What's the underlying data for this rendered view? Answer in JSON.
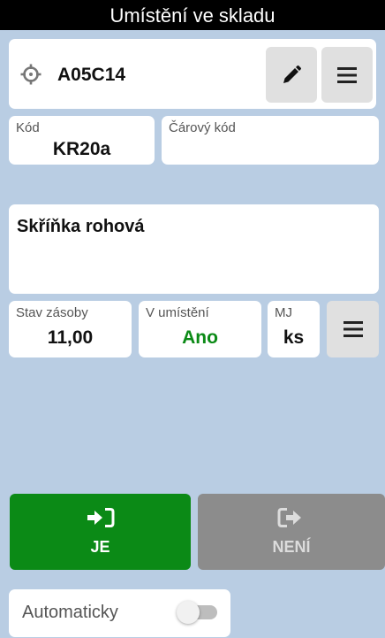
{
  "window": {
    "title": "Umístění ve skladu"
  },
  "location": {
    "code": "A05C14",
    "icon": "crosshair-icon",
    "edit_icon": "pencil-icon",
    "menu_icon": "hamburger-menu-icon"
  },
  "fields": {
    "kod": {
      "label": "Kód",
      "value": "KR20a"
    },
    "carovy_kod": {
      "label": "Čárový kód",
      "value": ""
    }
  },
  "item": {
    "name": "Skříňka rohová"
  },
  "stock": {
    "stav": {
      "label": "Stav zásoby",
      "value": "11,00"
    },
    "v_umisteni": {
      "label": "V umístění",
      "value": "Ano",
      "color": "#0b8a16"
    },
    "mj": {
      "label": "MJ",
      "value": "ks"
    },
    "menu_icon": "hamburger-menu-icon"
  },
  "actions": {
    "je": {
      "label": "JE",
      "icon": "sign-in-icon",
      "color": "#0b8a16"
    },
    "neni": {
      "label": "NENÍ",
      "icon": "sign-out-icon",
      "color": "#8c8c8c"
    }
  },
  "auto": {
    "label": "Automaticky",
    "enabled": false
  }
}
